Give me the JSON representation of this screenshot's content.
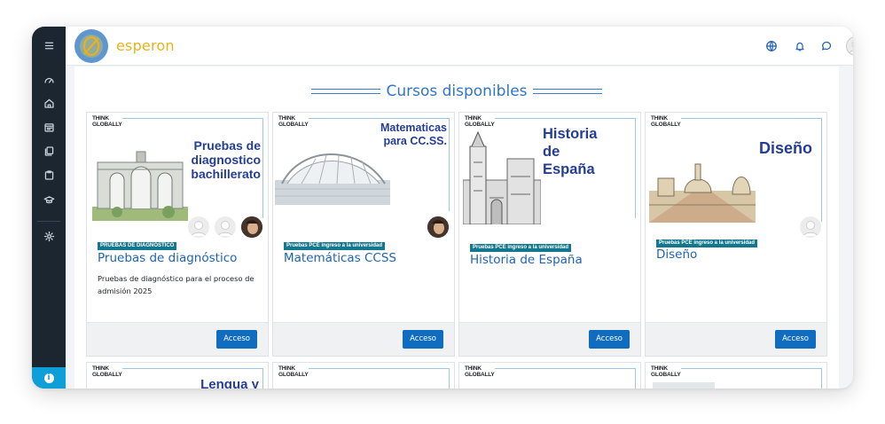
{
  "app": {
    "brand": "esperon",
    "colors": {
      "accent": "#0f6cbf",
      "brand": "#e7b21a",
      "sidebar": "#1c2631",
      "badge": "#13788d",
      "heading": "#2f76c6"
    }
  },
  "sidebar": {
    "items": [
      {
        "icon": "menu-icon"
      },
      {
        "icon": "dashboard-icon"
      },
      {
        "icon": "home-icon"
      },
      {
        "icon": "calendar-icon"
      },
      {
        "icon": "files-icon"
      },
      {
        "icon": "clipboard-icon"
      },
      {
        "icon": "graduation-cap-icon"
      },
      {
        "icon": "gear-icon"
      }
    ],
    "info_label": "i"
  },
  "topbar": {
    "icons": [
      "globe-icon",
      "bell-icon",
      "chat-icon",
      "avatar-icon"
    ],
    "caret": "▾"
  },
  "section": {
    "title": "Cursos disponibles"
  },
  "courses": [
    {
      "image_tag": "THINK\nGLOBALLY",
      "image_title": "Pruebas de diagnostico bachillerato",
      "badge": "PRUEBAS DE DIAGNOSTICO",
      "name": "Pruebas de diagnóstico",
      "description": "Pruebas de diagnóstico para el proceso de admisión 2025",
      "button": "Acceso"
    },
    {
      "image_tag": "THINK\nGLOBALLY",
      "image_title": "Matematicas para CC.SS.",
      "badge": "Pruebas PCE ingreso a la universidad",
      "name": "Matemáticas CCSS",
      "description": "",
      "button": "Acceso"
    },
    {
      "image_tag": "THINK\nGLOBALLY",
      "image_title": "Historia de España",
      "badge": "Pruebas PCE ingreso a la universidad",
      "name": "Historia de España",
      "description": "",
      "button": "Acceso"
    },
    {
      "image_tag": "THINK\nGLOBALLY",
      "image_title": "Diseño",
      "badge": "Pruebas PCE ingreso a la universidad",
      "name": "Diseño",
      "description": "",
      "button": "Acceso"
    }
  ],
  "courses_row2": [
    {
      "image_tag": "THINK\nGLOBALLY",
      "image_title": "Lengua y"
    },
    {
      "image_tag": "THINK\nGLOBALLY",
      "image_title": ""
    },
    {
      "image_tag": "THINK\nGLOBALLY",
      "image_title": ""
    },
    {
      "image_tag": "THINK\nGLOBALLY",
      "image_title": ""
    }
  ]
}
